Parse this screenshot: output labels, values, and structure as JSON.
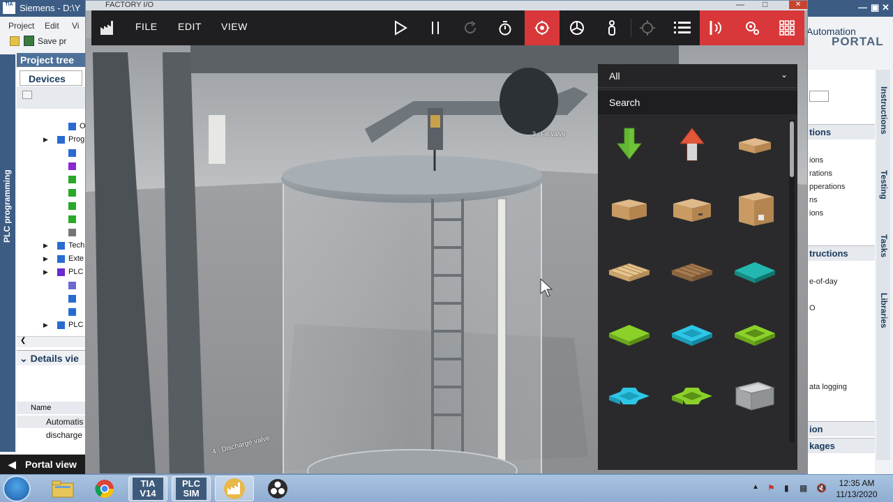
{
  "tia": {
    "title": "Siemens - D:\\Y",
    "logo_text": "TIA",
    "menu": [
      "Project",
      "Edit",
      "Vi"
    ],
    "save_label": "Save pr",
    "brand_automation": "Automation",
    "brand_portal": "PORTAL",
    "left_vertical_tab": "PLC programming",
    "project_tree_title": "Project tree",
    "devices_tab": "Devices",
    "tree_items": [
      {
        "label": "Onli",
        "indent": 2
      },
      {
        "label": "Prog",
        "indent": 1
      },
      {
        "label": "",
        "indent": 2
      },
      {
        "label": "",
        "indent": 2
      },
      {
        "label": "",
        "indent": 2
      },
      {
        "label": "",
        "indent": 2
      },
      {
        "label": "",
        "indent": 2
      },
      {
        "label": "",
        "indent": 2
      },
      {
        "label": "",
        "indent": 2
      },
      {
        "label": "Tech",
        "indent": 1
      },
      {
        "label": "Exte",
        "indent": 1
      },
      {
        "label": "PLC",
        "indent": 1
      },
      {
        "label": "",
        "indent": 2
      },
      {
        "label": "",
        "indent": 2
      },
      {
        "label": "",
        "indent": 2
      },
      {
        "label": "PLC",
        "indent": 1
      }
    ],
    "details_view": "Details vie",
    "details_name_header": "Name",
    "details_rows": [
      "Automatis",
      "discharge"
    ],
    "portal_view": "Portal view",
    "right_vertical_tabs": [
      "Instructions",
      "Testing",
      "Tasks",
      "Libraries"
    ],
    "right_sections": [
      {
        "title": "tions",
        "items": [
          "ions",
          "rations",
          "pperations",
          "ns",
          "ions"
        ]
      },
      {
        "title": "tructions",
        "items": [
          "e-of-day",
          "O",
          "ata logging"
        ]
      },
      {
        "title": "ion",
        "items": []
      },
      {
        "title": "kages",
        "items": []
      }
    ]
  },
  "fio": {
    "window_title": "FACTORY I/O",
    "menu": [
      "FILE",
      "EDIT",
      "VIEW"
    ],
    "toolbar_icons": [
      "play-icon",
      "pause-icon",
      "reset-icon",
      "stopwatch-icon",
      "camera-orbit-icon",
      "fly-camera-icon",
      "first-person-icon",
      "target-icon",
      "list-icon",
      "drivers-icon",
      "settings-icon",
      "parts-grid-icon"
    ],
    "accent": "#d8383a",
    "parts_filter": "All",
    "parts_search": "Search",
    "parts": [
      "green-arrow-down-icon",
      "red-arrow-up-icon",
      "flat-box-icon",
      "box-small-icon",
      "box-medium-icon",
      "box-large-icon",
      "pallet-light-icon",
      "pallet-dark-icon",
      "teal-plate-icon",
      "green-plate-icon",
      "cyan-frame-icon",
      "green-frame-icon",
      "cyan-cross-icon",
      "green-cross-icon",
      "grey-bin-icon"
    ],
    "scene_labels": {
      "fill_valve": "3 : Fill valve",
      "discharge_valve": "4 : Discharge valve"
    }
  },
  "taskbar": {
    "apps": [
      "start-orb-icon",
      "file-explorer-icon",
      "chrome-icon",
      "tia-v14-icon",
      "plcsim-icon",
      "factory-io-icon",
      "obs-icon"
    ],
    "tia_label": "TIA",
    "tia_ver": "V14",
    "plc_label": "PLC",
    "sim_label": "SIM",
    "time": "12:35 AM",
    "date": "11/13/2020"
  }
}
